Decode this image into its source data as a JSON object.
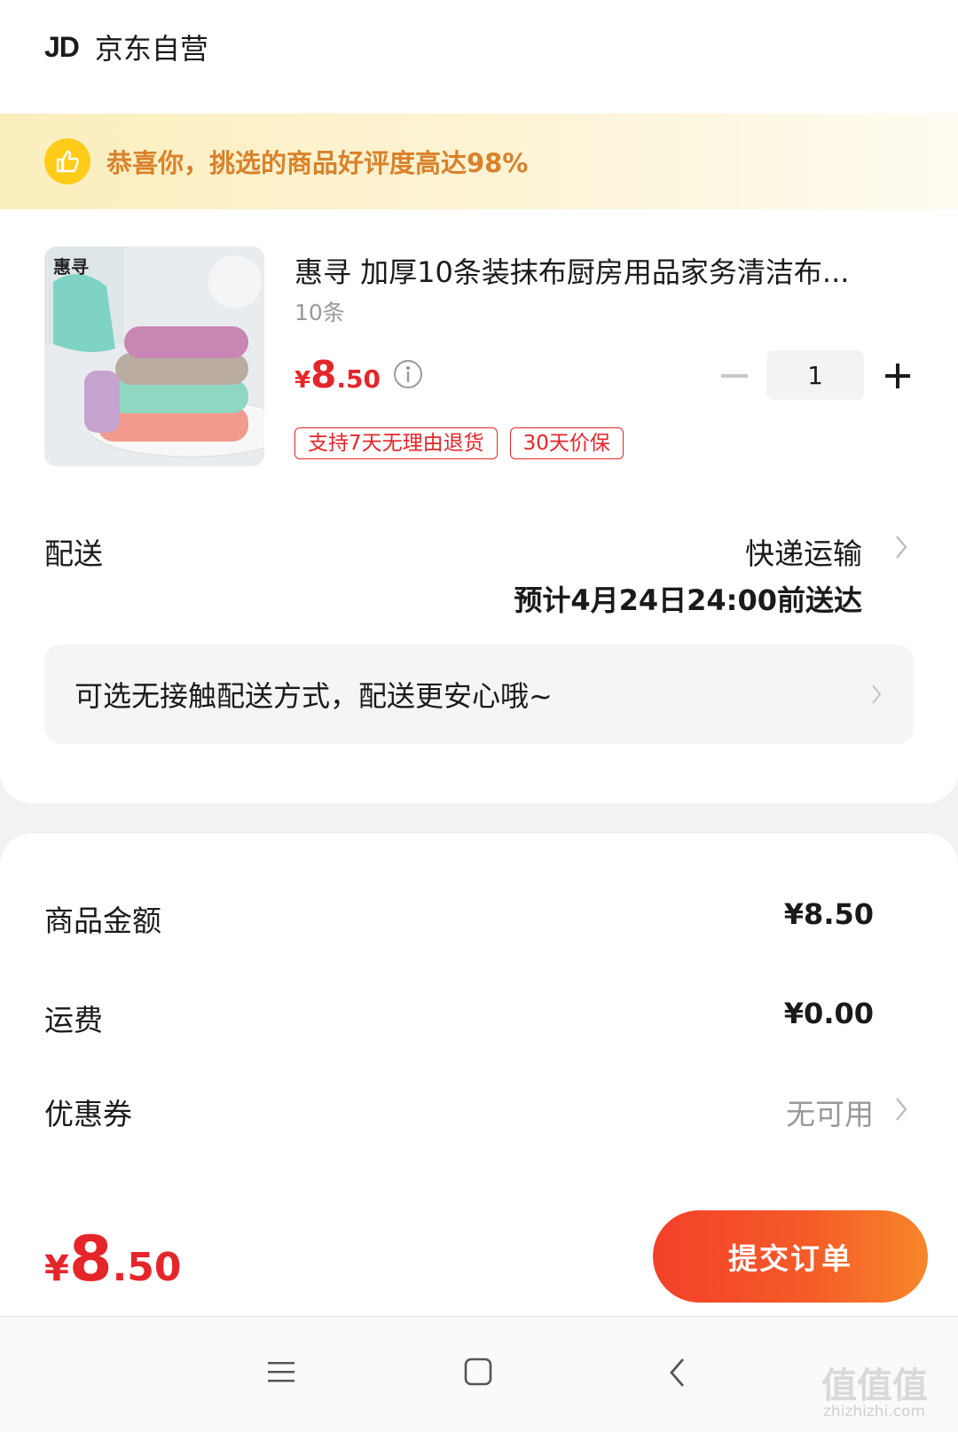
{
  "header": {
    "logo": "JD",
    "shop_name": "京东自营"
  },
  "praise": {
    "text": "恭喜你，挑选的商品好评度高达98%",
    "icon": "thumbs-up-icon"
  },
  "product": {
    "image_brand": "惠寻",
    "title": "惠寻 加厚10条装抹布厨房用品家务清洁布...",
    "spec": "10条",
    "price_yen": "¥",
    "price_int": "8",
    "price_dec": ".50",
    "quantity": "1",
    "tags": [
      "支持7天无理由退货",
      "30天价保"
    ]
  },
  "delivery": {
    "label": "配送",
    "method": "快递运输",
    "eta": "预计4月24日24:00前送达",
    "contactless": "可选无接触配送方式，配送更安心哦~"
  },
  "summary": {
    "goods_label": "商品金额",
    "goods_value": "¥8.50",
    "shipping_label": "运费",
    "shipping_value": "¥0.00",
    "coupon_label": "优惠券",
    "coupon_value": "无可用"
  },
  "footer": {
    "total_yen": "¥",
    "total_int": "8",
    "total_dec": ".50",
    "submit_label": "提交订单"
  },
  "watermark": {
    "text": "值值值",
    "sub": "zhizhizhi.com"
  },
  "colors": {
    "accent": "#e4262a",
    "button_start": "#f3402a",
    "button_end": "#f8862a",
    "praise_text": "#d9822b"
  }
}
